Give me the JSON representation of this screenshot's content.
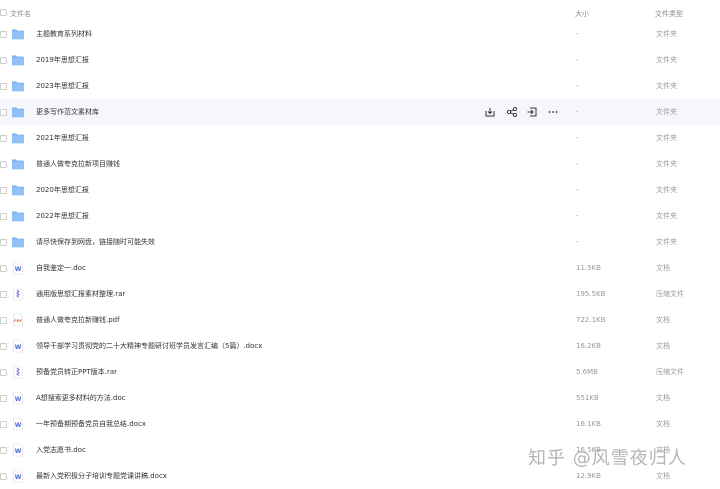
{
  "header": {
    "name_label": "文件名",
    "size_label": "大小",
    "type_label": "文件类型"
  },
  "colors": {
    "folder": "#7fb5f5",
    "word": "#3d6de0",
    "rar": "#6d6ce0",
    "pdf": "#e8624f",
    "hover_bg": "#f5f7fc",
    "watermark": "#b5b5b5"
  },
  "files": [
    {
      "name": "主题教育系列材料",
      "size": "-",
      "type": "文件夹",
      "icon": "folder-icon"
    },
    {
      "name": "2019年思想汇报",
      "size": "-",
      "type": "文件夹",
      "icon": "folder-icon"
    },
    {
      "name": "2023年思想汇报",
      "size": "-",
      "type": "文件夹",
      "icon": "folder-icon"
    },
    {
      "name": "更多写作范文素材库",
      "size": "-",
      "type": "文件夹",
      "icon": "folder-icon",
      "hovered": true
    },
    {
      "name": "2021年思想汇报",
      "size": "-",
      "type": "文件夹",
      "icon": "folder-icon"
    },
    {
      "name": "普通人做夸克拉新项目赚钱",
      "size": "-",
      "type": "文件夹",
      "icon": "folder-icon"
    },
    {
      "name": "2020年思想汇报",
      "size": "-",
      "type": "文件夹",
      "icon": "folder-icon"
    },
    {
      "name": "2022年思想汇报",
      "size": "-",
      "type": "文件夹",
      "icon": "folder-icon"
    },
    {
      "name": "请尽快保存到网盘，链接随时可能失效",
      "size": "-",
      "type": "文件夹",
      "icon": "folder-icon"
    },
    {
      "name": "自我鉴定一.doc",
      "size": "11.5KB",
      "type": "文档",
      "icon": "word-doc-icon"
    },
    {
      "name": "通用版思想汇报素材整理.rar",
      "size": "195.5KB",
      "type": "压缩文件",
      "icon": "rar-archive-icon"
    },
    {
      "name": "普通人做夸克拉新赚钱.pdf",
      "size": "722.1KB",
      "type": "文档",
      "icon": "pdf-icon"
    },
    {
      "name": "领导干部学习贯彻党的二十大精神专题研讨班学员发言汇编（5篇）.docx",
      "size": "16.2KB",
      "type": "文档",
      "icon": "word-doc-icon"
    },
    {
      "name": "预备党员转正PPT版本.rar",
      "size": "5.6MB",
      "type": "压缩文件",
      "icon": "rar-archive-icon"
    },
    {
      "name": "A想搜索更多材料的方法.doc",
      "size": "551KB",
      "type": "文档",
      "icon": "word-doc-icon"
    },
    {
      "name": "一年预备期预备党员自我总结.docx",
      "size": "16.1KB",
      "type": "文档",
      "icon": "word-doc-icon"
    },
    {
      "name": "入党志愿书.doc",
      "size": "16.5KB",
      "type": "文档",
      "icon": "word-doc-icon"
    },
    {
      "name": "最新入党积极分子培训专题党课讲稿.docx",
      "size": "12.9KB",
      "type": "文档",
      "icon": "word-doc-icon"
    }
  ],
  "hover_actions": [
    {
      "icon": "download-icon"
    },
    {
      "icon": "share-icon"
    },
    {
      "icon": "move-icon"
    },
    {
      "icon": "more-icon"
    }
  ],
  "watermark": "知乎 @风雪夜归人"
}
